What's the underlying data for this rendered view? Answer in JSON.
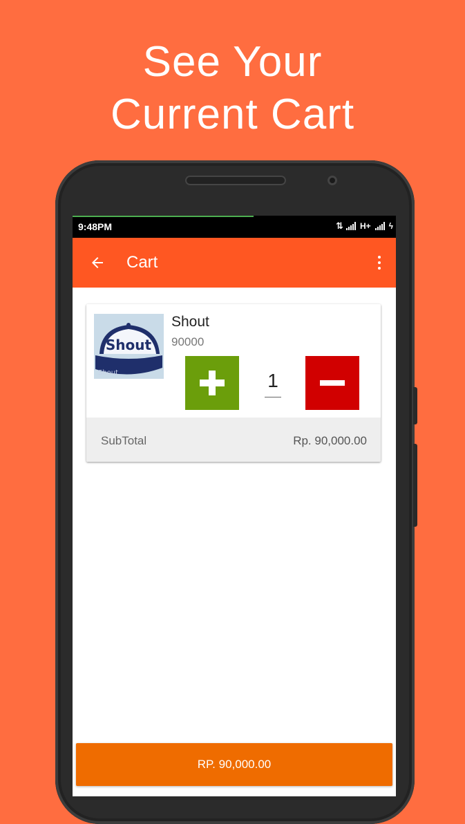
{
  "promo": {
    "line1": "See Your",
    "line2": "Current Cart"
  },
  "status_bar": {
    "time": "9:48PM",
    "network_label": "H+",
    "download_progress": 0.56
  },
  "app_bar": {
    "title": "Cart",
    "back_icon": "arrow-left-icon",
    "menu_icon": "more-vert-icon"
  },
  "cart": {
    "items": [
      {
        "name": "Shout",
        "price": "90000",
        "image_text": "Shout",
        "image_subtext": "Shout",
        "quantity": "1"
      }
    ],
    "subtotal_label": "SubTotal",
    "subtotal_value": "Rp. 90,000.00"
  },
  "checkout": {
    "label": "RP. 90,000.00"
  },
  "colors": {
    "background": "#FF6D40",
    "app_bar": "#FF5722",
    "plus_button": "#6B9E0B",
    "minus_button": "#D10000",
    "checkout_button": "#EF6C00"
  }
}
